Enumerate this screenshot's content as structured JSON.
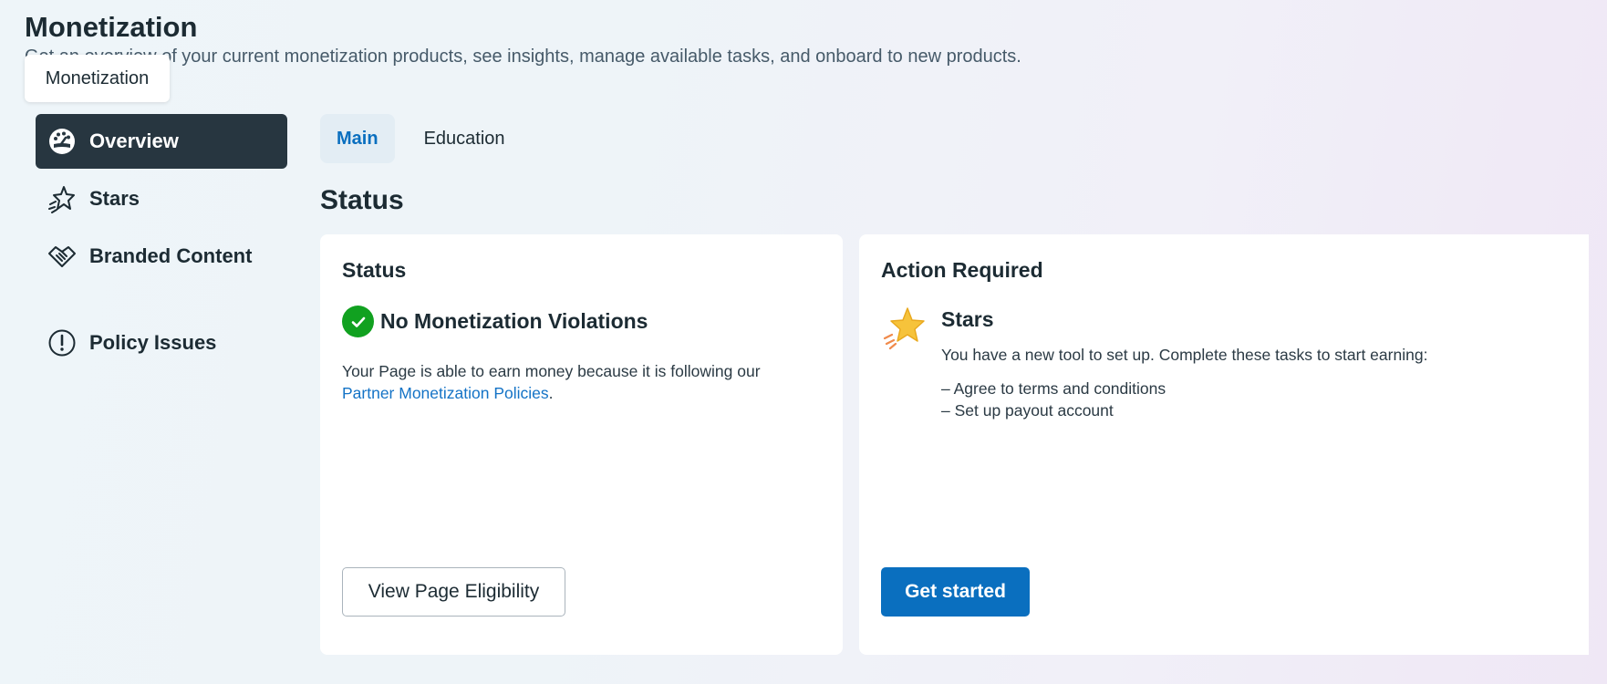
{
  "header": {
    "title": "Monetization",
    "subtitle": "Get an overview of your current monetization products, see insights, manage available tasks, and onboard to new products."
  },
  "tooltip": {
    "text": "Monetization"
  },
  "sidebar": {
    "items": [
      {
        "label": "Overview",
        "icon": "dashboard-gauge-icon",
        "active": true
      },
      {
        "label": "Stars",
        "icon": "star-outline-icon"
      },
      {
        "label": "Branded Content",
        "icon": "handshake-icon"
      },
      {
        "label": "Policy Issues",
        "icon": "exclamation-circle-icon"
      }
    ]
  },
  "tabs": [
    {
      "label": "Main",
      "active": true
    },
    {
      "label": "Education"
    }
  ],
  "section": {
    "title": "Status"
  },
  "status_card": {
    "heading": "Status",
    "status_text": "No Monetization Violations",
    "description": "Your Page is able to earn money because it is following our",
    "link_text": "Partner Monetization Policies",
    "link_suffix": ".",
    "button_label": "View Page Eligibility"
  },
  "action_card": {
    "heading": "Action Required",
    "product": "Stars",
    "description": "You have a new tool to set up. Complete these tasks to start earning:",
    "tasks": [
      "– Agree to terms and conditions",
      "– Set up payout account"
    ],
    "button_label": "Get started"
  },
  "colors": {
    "active_nav_bg": "#273640",
    "primary_button": "#0a6fbf",
    "link": "#1473c6",
    "success": "#11a120",
    "star": "#f6c33b"
  }
}
